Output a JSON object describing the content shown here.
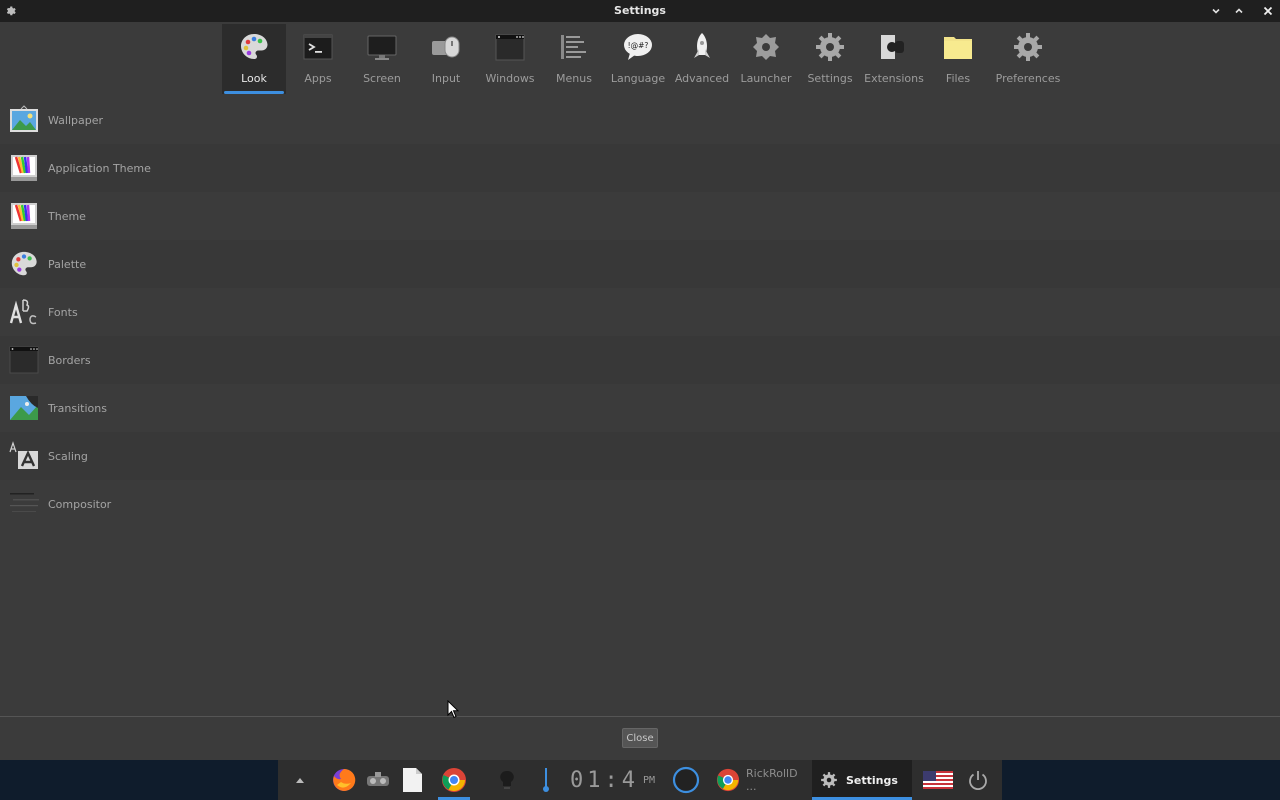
{
  "window": {
    "title": "Settings",
    "controls": [
      "minimize",
      "maximize",
      "close"
    ]
  },
  "categories": [
    {
      "label": "Look",
      "icon": "palette-icon",
      "active": true
    },
    {
      "label": "Apps",
      "icon": "terminal-icon"
    },
    {
      "label": "Screen",
      "icon": "monitor-icon"
    },
    {
      "label": "Input",
      "icon": "mouse-icon"
    },
    {
      "label": "Windows",
      "icon": "window-icon"
    },
    {
      "label": "Menus",
      "icon": "menu-icon"
    },
    {
      "label": "Language",
      "icon": "speech-bubble-icon",
      "bubble_text": "!@#?"
    },
    {
      "label": "Advanced",
      "icon": "rocket-icon"
    },
    {
      "label": "Launcher",
      "icon": "launcher-gear-icon"
    },
    {
      "label": "Settings",
      "icon": "gear-icon"
    },
    {
      "label": "Extensions",
      "icon": "plug-icon"
    },
    {
      "label": "Files",
      "icon": "folder-icon"
    },
    {
      "label": "Preferences",
      "icon": "preferences-gear-icon"
    }
  ],
  "items": [
    {
      "label": "Wallpaper",
      "icon": "wallpaper-icon"
    },
    {
      "label": "Application Theme",
      "icon": "app-theme-icon"
    },
    {
      "label": "Theme",
      "icon": "theme-icon"
    },
    {
      "label": "Palette",
      "icon": "palette-icon"
    },
    {
      "label": "Fonts",
      "icon": "fonts-icon"
    },
    {
      "label": "Borders",
      "icon": "borders-icon"
    },
    {
      "label": "Transitions",
      "icon": "transitions-icon"
    },
    {
      "label": "Scaling",
      "icon": "scaling-icon"
    },
    {
      "label": "Compositor",
      "icon": "compositor-icon"
    }
  ],
  "footer": {
    "close_label": "Close"
  },
  "taskbar": {
    "clock_digits": "01:4",
    "ampm": "PM",
    "chrome_task_label": "RickRollD ...",
    "settings_task_label": "Settings",
    "accent_color": "#3d8fe0"
  }
}
